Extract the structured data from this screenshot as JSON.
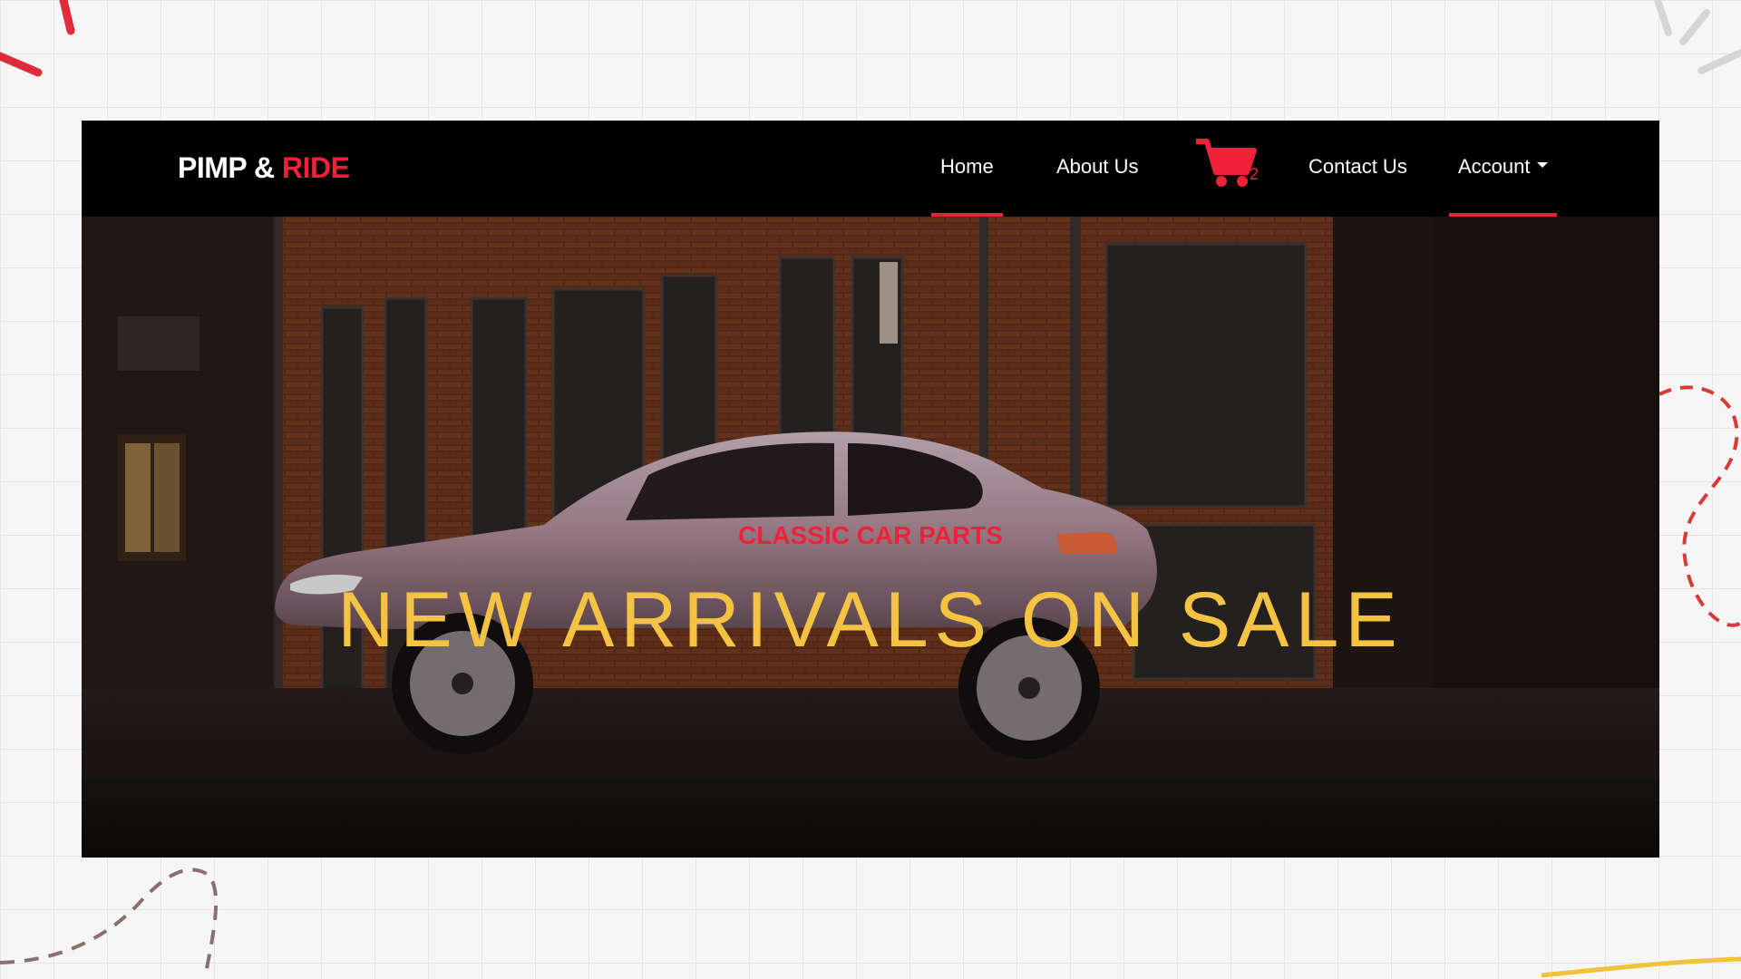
{
  "brand": {
    "part1": "PIMP & ",
    "part2": "RIDE"
  },
  "nav": {
    "home": "Home",
    "about": "About Us",
    "contact": "Contact Us",
    "account": "Account",
    "cart_count": "2",
    "active": [
      "Home",
      "Account"
    ]
  },
  "hero": {
    "subtitle": "CLASSIC CAR PARTS",
    "title": "NEW ARRIVALS ON SALE"
  },
  "icons": [
    "cart-icon",
    "caret-down-icon"
  ],
  "colors": {
    "accent": "#ee2138",
    "title": "#f5c343",
    "navbar": "#000000",
    "car": "#c8a9b8",
    "brick": "#7a3a1e"
  }
}
